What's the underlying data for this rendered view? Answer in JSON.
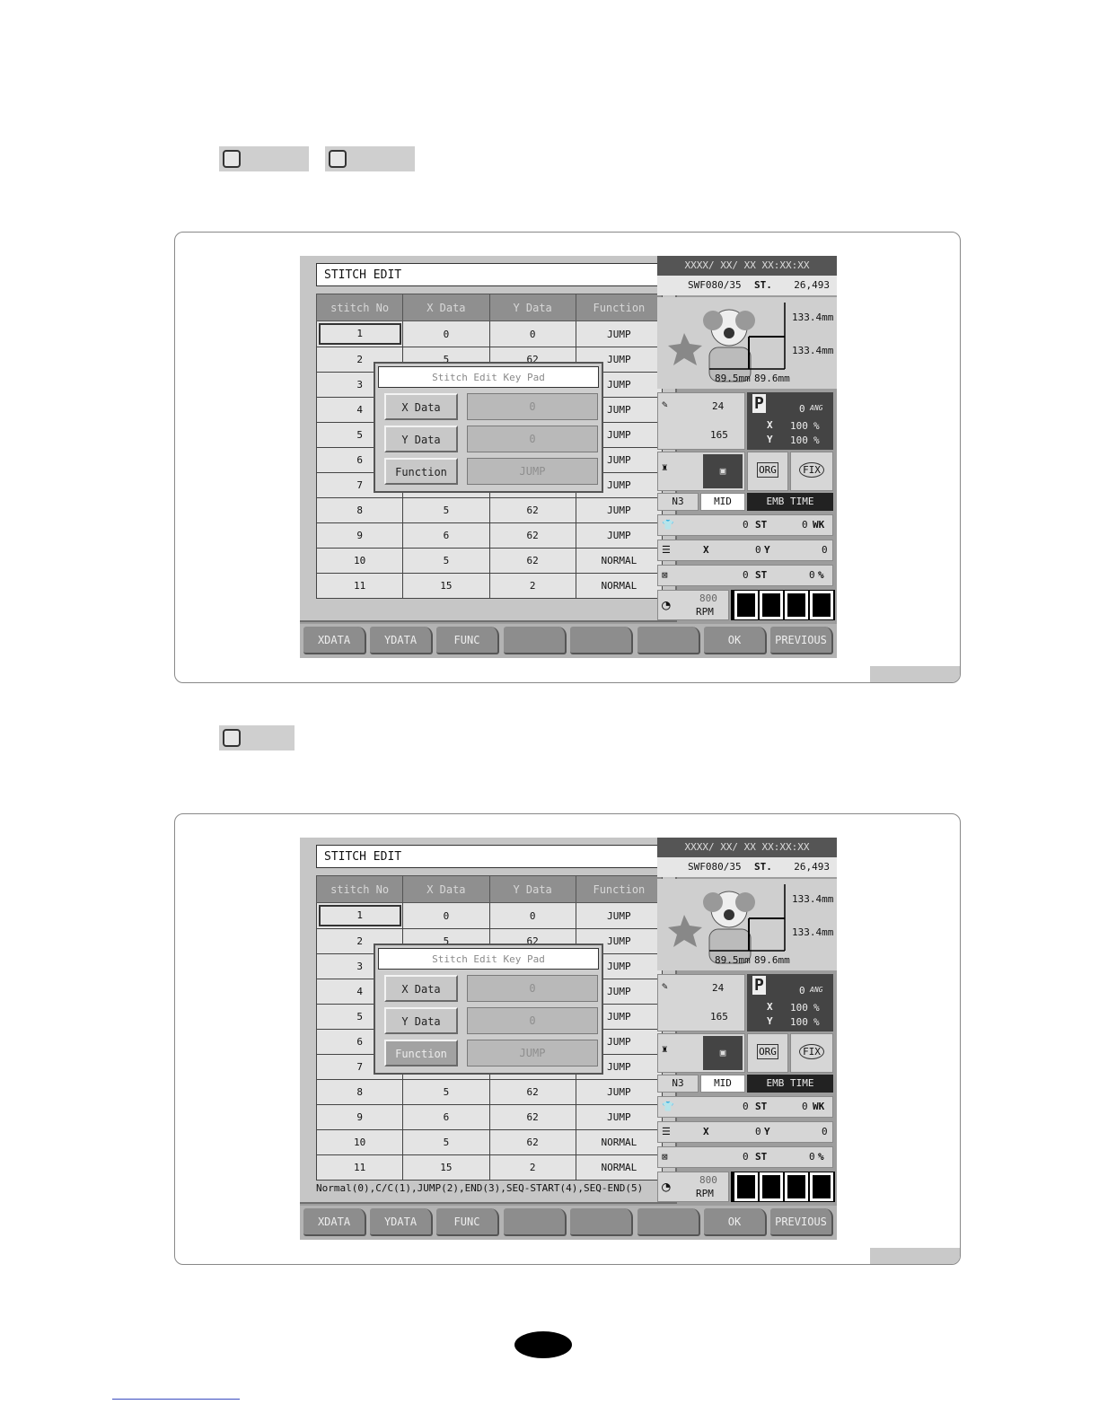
{
  "screens": [
    {
      "title": "STITCH  EDIT",
      "columns": [
        "stitch  No",
        "X  Data",
        "Y  Data",
        "Function"
      ],
      "rows": [
        [
          "1",
          "0",
          "0",
          "JUMP"
        ],
        [
          "2",
          "5",
          "62",
          "JUMP"
        ],
        [
          "3",
          "",
          "",
          "JUMP"
        ],
        [
          "4",
          "",
          "",
          "JUMP"
        ],
        [
          "5",
          "",
          "",
          "JUMP"
        ],
        [
          "6",
          "",
          "",
          "JUMP"
        ],
        [
          "7",
          "",
          "",
          "JUMP"
        ],
        [
          "8",
          "5",
          "62",
          "JUMP"
        ],
        [
          "9",
          "6",
          "62",
          "JUMP"
        ],
        [
          "10",
          "5",
          "62",
          "NORMAL"
        ],
        [
          "11",
          "15",
          "2",
          "NORMAL"
        ]
      ],
      "hint": "",
      "keypad": {
        "title": "Stitch  Edit  Key  Pad",
        "x_label": "X  Data",
        "x_value": "0",
        "y_label": "Y  Data",
        "y_value": "0",
        "func_label": "Function",
        "func_value": "JUMP",
        "func_active": false
      }
    },
    {
      "title": "STITCH  EDIT",
      "columns": [
        "stitch  No",
        "X  Data",
        "Y  Data",
        "Function"
      ],
      "rows": [
        [
          "1",
          "0",
          "0",
          "JUMP"
        ],
        [
          "2",
          "5",
          "62",
          "JUMP"
        ],
        [
          "3",
          "",
          "",
          "JUMP"
        ],
        [
          "4",
          "",
          "",
          "JUMP"
        ],
        [
          "5",
          "",
          "",
          "JUMP"
        ],
        [
          "6",
          "",
          "",
          "JUMP"
        ],
        [
          "7",
          "",
          "",
          "JUMP"
        ],
        [
          "8",
          "5",
          "62",
          "JUMP"
        ],
        [
          "9",
          "6",
          "62",
          "JUMP"
        ],
        [
          "10",
          "5",
          "62",
          "NORMAL"
        ],
        [
          "11",
          "15",
          "2",
          "NORMAL"
        ]
      ],
      "hint": "Normal(0),C/C(1),JUMP(2),END(3),SEQ-START(4),SEQ-END(5)",
      "keypad": {
        "title": "Stitch  Edit  Key  Pad",
        "x_label": "X  Data",
        "x_value": "0",
        "y_label": "Y  Data",
        "y_value": "0",
        "func_label": "Function",
        "func_value": "JUMP",
        "func_active": true
      }
    }
  ],
  "status": {
    "datetime": "XXXX/ XX/ XX  XX:XX:XX",
    "model": "SWF080/35",
    "st_label": "ST.",
    "st_value": "26,493",
    "dim_h1": "133.4mm",
    "dim_h2": "133.4mm",
    "dim_w1": "89.5mm",
    "dim_w2": "89.6mm",
    "needle_top": "24",
    "needle_bottom": "165",
    "p_value": "0",
    "ang_label": "ANG",
    "x_pct": "100",
    "y_pct": "100",
    "pct_sign": "%",
    "org_label": "ORG",
    "fix_label": "FIX",
    "n_label": "N3",
    "mid_label": "MID",
    "emb_time_label": "EMB  TIME",
    "count_st": "0",
    "st_unit": "ST",
    "count_wk": "0",
    "wk_unit": "WK",
    "x_label": "X",
    "x_coord": "0",
    "y_label": "Y",
    "y_coord": "0",
    "stop_st": "0",
    "stop_pct": "0",
    "rpm_value": "800",
    "rpm_label": "RPM"
  },
  "softkeys": [
    "XDATA",
    "YDATA",
    "FUNC",
    "",
    "",
    "",
    "OK",
    "PREVIOUS"
  ],
  "icons": [
    "clown-design-icon",
    "needle-icon",
    "thread-icon",
    "frame-icon",
    "shirt-icon",
    "frame-xy-icon",
    "stop-icon",
    "speedometer-icon"
  ]
}
